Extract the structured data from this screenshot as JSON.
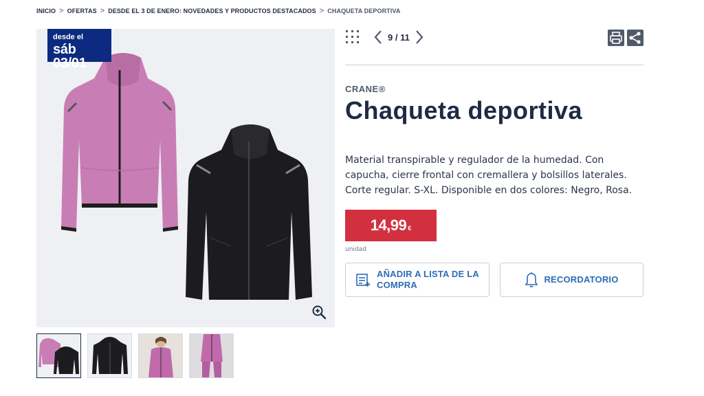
{
  "breadcrumb": {
    "items": [
      "INICIO",
      "OFERTAS",
      "DESDE EL 3 DE ENERO: NOVEDADES Y PRODUCTOS DESTACADOS"
    ],
    "current": "CHAQUETA DEPORTIVA",
    "separator": ">"
  },
  "badge": {
    "line1": "desde el",
    "line2": "sáb 03/01"
  },
  "pager": {
    "text": "9 / 11"
  },
  "product": {
    "brand": "CRANE®",
    "title": "Chaqueta deportiva",
    "description": "Material transpirable y regulador de la humedad. Con capucha, cierre frontal con cremallera y bolsillos laterales. Corte regular. S-XL. Disponible en dos colores: Negro, Rosa.",
    "price": "14,99",
    "currency": "€",
    "unit": "unidad"
  },
  "actions": {
    "add_to_list": "AÑADIR A LISTA DE LA COMPRA",
    "reminder": "RECORDATORIO"
  },
  "icons": {
    "grid": "grid-icon",
    "prev": "chevron-left-icon",
    "next": "chevron-right-icon",
    "print": "print-icon",
    "share": "share-icon",
    "zoom": "zoom-in-icon",
    "list": "shopping-list-icon",
    "bell": "bell-icon"
  },
  "colors": {
    "navy": "#1f2a44",
    "badge": "#0b2a80",
    "price": "#d2303f",
    "link": "#2b6cb5",
    "pink": "#c77cb4",
    "black": "#1c1c1e"
  },
  "thumbnails": [
    "both jackets",
    "black jacket",
    "model pink 1",
    "model pink 2"
  ]
}
